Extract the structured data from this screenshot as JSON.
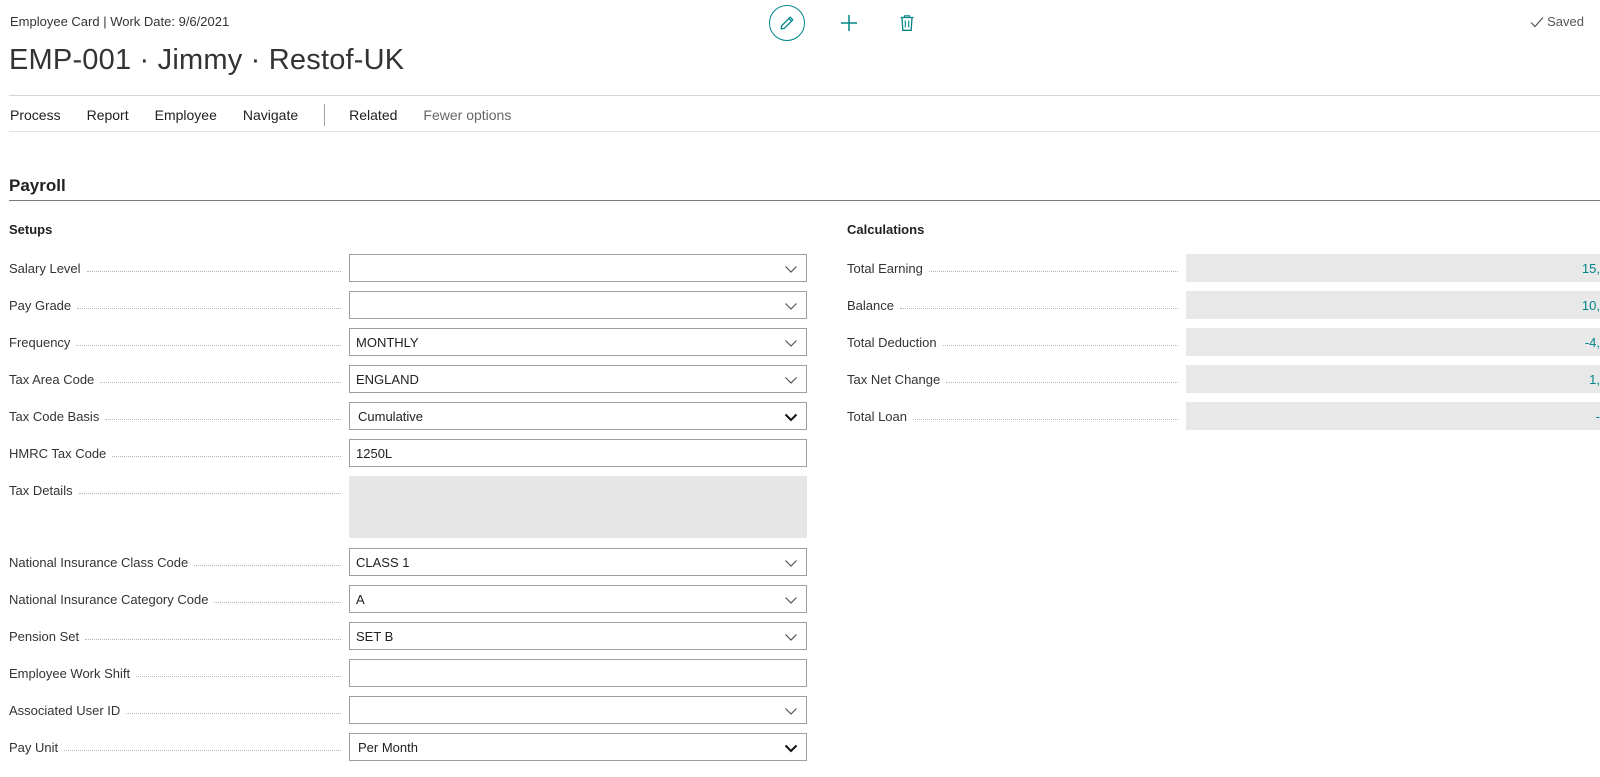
{
  "header": {
    "breadcrumb": "Employee Card | Work Date: 9/6/2021",
    "title": "EMP-001 · Jimmy · Restof-UK",
    "saved": "Saved",
    "accent_color": "#00858a",
    "icons": {
      "edit": "pencil-icon",
      "new": "plus-icon",
      "delete": "trash-icon",
      "saved": "check-icon"
    }
  },
  "menu": {
    "items": [
      "Process",
      "Report",
      "Employee",
      "Navigate"
    ],
    "related": "Related",
    "fewer_options": "Fewer options"
  },
  "section": {
    "title": "Payroll"
  },
  "setups": {
    "title": "Setups",
    "fields": [
      {
        "label": "Salary Level",
        "value": "",
        "type": "dropdown"
      },
      {
        "label": "Pay Grade",
        "value": "",
        "type": "dropdown"
      },
      {
        "label": "Frequency",
        "value": "MONTHLY",
        "type": "dropdown"
      },
      {
        "label": "Tax Area Code",
        "value": "ENGLAND",
        "type": "dropdown"
      },
      {
        "label": "Tax Code Basis",
        "value": "Cumulative",
        "type": "select"
      },
      {
        "label": "HMRC Tax Code",
        "value": "1250L",
        "type": "text"
      },
      {
        "label": "Tax Details",
        "value": "",
        "type": "textarea-disabled"
      },
      {
        "label": "National Insurance Class Code",
        "value": "CLASS 1",
        "type": "dropdown"
      },
      {
        "label": "National Insurance Category Code",
        "value": "A",
        "type": "dropdown"
      },
      {
        "label": "Pension Set",
        "value": "SET B",
        "type": "dropdown"
      },
      {
        "label": "Employee Work Shift",
        "value": "",
        "type": "text"
      },
      {
        "label": "Associated User ID",
        "value": "",
        "type": "dropdown"
      },
      {
        "label": "Pay Unit",
        "value": "Per Month",
        "type": "select"
      }
    ]
  },
  "calculations": {
    "title": "Calculations",
    "fields": [
      {
        "label": "Total Earning",
        "value": "15,"
      },
      {
        "label": "Balance",
        "value": "10,"
      },
      {
        "label": "Total Deduction",
        "value": "-4,"
      },
      {
        "label": "Tax Net Change",
        "value": "1,"
      },
      {
        "label": "Total Loan",
        "value": "-"
      }
    ]
  }
}
